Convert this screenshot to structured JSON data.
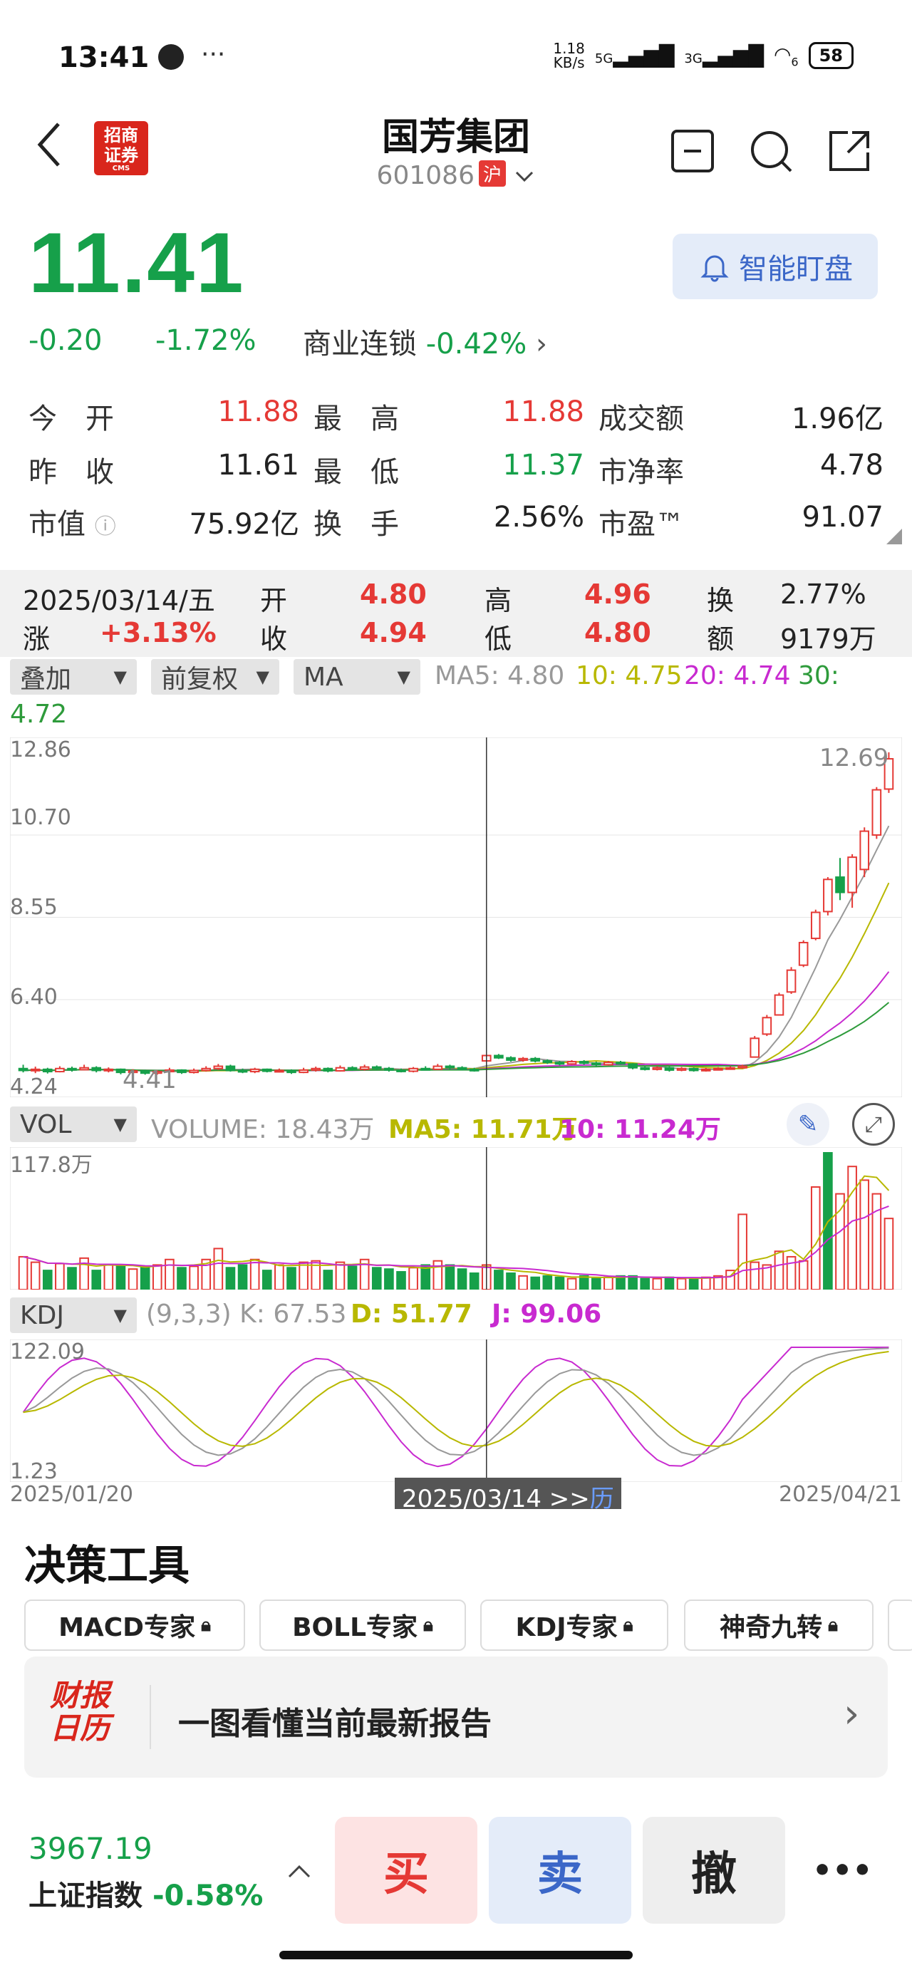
{
  "status_bar": {
    "time": "13:41",
    "net_speed_top": "1.18",
    "net_speed_unit": "KB/s",
    "sig1": "5G",
    "sig2": "3G",
    "wifi_sub": "6",
    "battery": "58"
  },
  "header": {
    "logo_line1": "招商",
    "logo_line2": "证券",
    "logo_sub": "CMS",
    "title": "国芳集团",
    "code": "601086",
    "exchange_badge": "沪"
  },
  "quote": {
    "price": "11.41",
    "change": "-0.20",
    "change_pct": "-1.72%",
    "sector_name": "商业连锁",
    "sector_pct": "-0.42%",
    "alert_label": "智能盯盘",
    "colors": {
      "up": "#e53935",
      "down": "#16a04a",
      "neutral": "#222222"
    }
  },
  "stats": {
    "open_label": "今　开",
    "open": "11.88",
    "high_label": "最　高",
    "high": "11.88",
    "amount_label": "成交额",
    "amount": "1.96亿",
    "prev_label": "昨　收",
    "prev": "11.61",
    "low_label": "最　低",
    "low": "11.37",
    "pb_label": "市净率",
    "pb": "4.78",
    "mcap_label": "市值",
    "mcap": "75.92亿",
    "turn_label": "换　手",
    "turn": "2.56%",
    "pe_label": "市盈™",
    "pe": "91.07"
  },
  "day_detail": {
    "date": "2025/03/14/五",
    "open_l": "开",
    "open": "4.80",
    "high_l": "高",
    "high": "4.96",
    "turn_l": "换",
    "turn": "2.77%",
    "chg_l": "涨",
    "chg": "+3.13%",
    "close_l": "收",
    "close": "4.94",
    "low_l": "低",
    "low": "4.80",
    "amt_l": "额",
    "amt": "9179万"
  },
  "indicators": {
    "overlay": "叠加",
    "adjust": "前复权",
    "ma": "MA",
    "ma5": "MA5: 4.80",
    "ma10": "10: 4.75",
    "ma20": "20: 4.74",
    "ma30_l": "30:",
    "ma30": "4.72",
    "vol": "VOL",
    "volume": "VOLUME: 18.43万",
    "vol_ma5": "MA5: 11.71万",
    "vol_ma10": "10: 11.24万",
    "kdj": "KDJ",
    "kdj_params": "(9,3,3) K: 67.53",
    "kdj_d": "D: 51.77",
    "kdj_j": "J: 99.06"
  },
  "chart_data": {
    "type": "candlestick",
    "price_axis": [
      "12.86",
      "10.70",
      "8.55",
      "6.40",
      "4.24"
    ],
    "price_max_label": "12.69",
    "price_min_label": "4.41",
    "vol_axis": "117.8万",
    "kdj_axis_top": "122.09",
    "kdj_axis_bottom": "1.23",
    "x_start": "2025/01/20",
    "x_cursor": "2025/03/14 >>",
    "x_cursor_suffix": "历",
    "x_end": "2025/04/21",
    "ylim": [
      4.0,
      13.1
    ],
    "candles": [
      [
        4.6,
        4.55,
        4.7,
        4.5
      ],
      [
        4.55,
        4.58,
        4.65,
        4.48
      ],
      [
        4.58,
        4.52,
        4.62,
        4.47
      ],
      [
        4.52,
        4.6,
        4.66,
        4.5
      ],
      [
        4.6,
        4.57,
        4.65,
        4.52
      ],
      [
        4.57,
        4.62,
        4.7,
        4.55
      ],
      [
        4.62,
        4.55,
        4.66,
        4.5
      ],
      [
        4.55,
        4.58,
        4.63,
        4.5
      ],
      [
        4.58,
        4.5,
        4.6,
        4.45
      ],
      [
        4.5,
        4.54,
        4.58,
        4.45
      ],
      [
        4.54,
        4.48,
        4.57,
        4.44
      ],
      [
        4.48,
        4.52,
        4.56,
        4.44
      ],
      [
        4.52,
        4.56,
        4.62,
        4.48
      ],
      [
        4.56,
        4.5,
        4.58,
        4.46
      ],
      [
        4.5,
        4.55,
        4.6,
        4.47
      ],
      [
        4.55,
        4.6,
        4.66,
        4.52
      ],
      [
        4.6,
        4.66,
        4.72,
        4.56
      ],
      [
        4.66,
        4.55,
        4.7,
        4.52
      ],
      [
        4.55,
        4.52,
        4.6,
        4.48
      ],
      [
        4.52,
        4.58,
        4.62,
        4.48
      ],
      [
        4.58,
        4.53,
        4.6,
        4.5
      ],
      [
        4.53,
        4.55,
        4.6,
        4.5
      ],
      [
        4.55,
        4.5,
        4.58,
        4.46
      ],
      [
        4.5,
        4.56,
        4.62,
        4.48
      ],
      [
        4.56,
        4.6,
        4.65,
        4.52
      ],
      [
        4.6,
        4.54,
        4.63,
        4.5
      ],
      [
        4.54,
        4.62,
        4.68,
        4.52
      ],
      [
        4.62,
        4.58,
        4.66,
        4.54
      ],
      [
        4.58,
        4.64,
        4.7,
        4.55
      ],
      [
        4.64,
        4.6,
        4.68,
        4.56
      ],
      [
        4.6,
        4.56,
        4.64,
        4.52
      ],
      [
        4.56,
        4.53,
        4.6,
        4.5
      ],
      [
        4.53,
        4.6,
        4.64,
        4.5
      ],
      [
        4.6,
        4.58,
        4.66,
        4.55
      ],
      [
        4.58,
        4.66,
        4.72,
        4.56
      ],
      [
        4.66,
        4.62,
        4.7,
        4.58
      ],
      [
        4.62,
        4.58,
        4.66,
        4.55
      ],
      [
        4.58,
        4.55,
        4.62,
        4.52
      ],
      [
        4.8,
        4.94,
        4.96,
        4.8
      ],
      [
        4.94,
        4.88,
        4.98,
        4.85
      ],
      [
        4.88,
        4.82,
        4.92,
        4.78
      ],
      [
        4.82,
        4.86,
        4.9,
        4.78
      ],
      [
        4.86,
        4.8,
        4.9,
        4.76
      ],
      [
        4.8,
        4.76,
        4.84,
        4.72
      ],
      [
        4.76,
        4.72,
        4.8,
        4.68
      ],
      [
        4.72,
        4.78,
        4.82,
        4.7
      ],
      [
        4.78,
        4.74,
        4.82,
        4.7
      ],
      [
        4.74,
        4.7,
        4.78,
        4.66
      ],
      [
        4.7,
        4.76,
        4.8,
        4.68
      ],
      [
        4.76,
        4.72,
        4.8,
        4.7
      ],
      [
        4.72,
        4.62,
        4.74,
        4.58
      ],
      [
        4.62,
        4.58,
        4.66,
        4.55
      ],
      [
        4.58,
        4.62,
        4.66,
        4.55
      ],
      [
        4.62,
        4.56,
        4.65,
        4.52
      ],
      [
        4.56,
        4.6,
        4.64,
        4.53
      ],
      [
        4.6,
        4.55,
        4.63,
        4.52
      ],
      [
        4.55,
        4.58,
        4.62,
        4.52
      ],
      [
        4.58,
        4.6,
        4.64,
        4.55
      ],
      [
        4.6,
        4.62,
        4.66,
        4.58
      ],
      [
        4.62,
        4.66,
        4.7,
        4.6
      ],
      [
        4.9,
        5.39,
        5.45,
        4.9
      ],
      [
        5.5,
        5.93,
        6.0,
        5.45
      ],
      [
        6.0,
        6.52,
        6.58,
        6.0
      ],
      [
        6.6,
        7.17,
        7.25,
        6.55
      ],
      [
        7.3,
        7.89,
        7.95,
        7.25
      ],
      [
        8.0,
        8.68,
        8.75,
        7.95
      ],
      [
        8.7,
        9.54,
        9.6,
        8.6
      ],
      [
        9.6,
        9.2,
        10.1,
        9.0
      ],
      [
        9.2,
        10.12,
        10.2,
        8.8
      ],
      [
        9.8,
        10.8,
        10.9,
        9.6
      ],
      [
        10.7,
        11.88,
        11.95,
        10.6
      ],
      [
        11.9,
        12.69,
        12.86,
        11.8
      ]
    ],
    "volume_pct": [
      24,
      20,
      14,
      19,
      16,
      23,
      14,
      18,
      18,
      15,
      17,
      18,
      22,
      16,
      17,
      22,
      30,
      16,
      18,
      22,
      14,
      18,
      16,
      20,
      21,
      14,
      20,
      17,
      22,
      16,
      15,
      13,
      16,
      18,
      21,
      18,
      15,
      12,
      18,
      14,
      12,
      10,
      9,
      10,
      9,
      8,
      10,
      8,
      9,
      10,
      10,
      8,
      8,
      9,
      8,
      8,
      9,
      10,
      14,
      55,
      20,
      18,
      28,
      24,
      21,
      75,
      100,
      70,
      90,
      80,
      70,
      52
    ],
    "volume_up": [
      1,
      1,
      0,
      1,
      0,
      1,
      0,
      1,
      0,
      1,
      0,
      1,
      1,
      0,
      1,
      1,
      1,
      0,
      0,
      1,
      0,
      1,
      0,
      1,
      1,
      0,
      1,
      0,
      1,
      0,
      0,
      0,
      1,
      0,
      1,
      0,
      0,
      0,
      1,
      0,
      0,
      1,
      0,
      0,
      0,
      1,
      0,
      0,
      1,
      0,
      0,
      0,
      1,
      0,
      1,
      0,
      1,
      1,
      1,
      1,
      1,
      1,
      1,
      1,
      1,
      1,
      0,
      1,
      1,
      1,
      1,
      1
    ]
  },
  "tools": {
    "section_title": "决策工具",
    "items": [
      "MACD专家",
      "BOLL专家",
      "KDJ专家",
      "神奇九转"
    ],
    "report_logo1": "财报",
    "report_logo2": "日历",
    "report_text": "一图看懂当前最新报告"
  },
  "bottom": {
    "index_value": "3967.19",
    "index_name": "上证指数",
    "index_pct": "-0.58%",
    "buy": "买",
    "sell": "卖",
    "cancel": "撤",
    "more": "•••"
  }
}
